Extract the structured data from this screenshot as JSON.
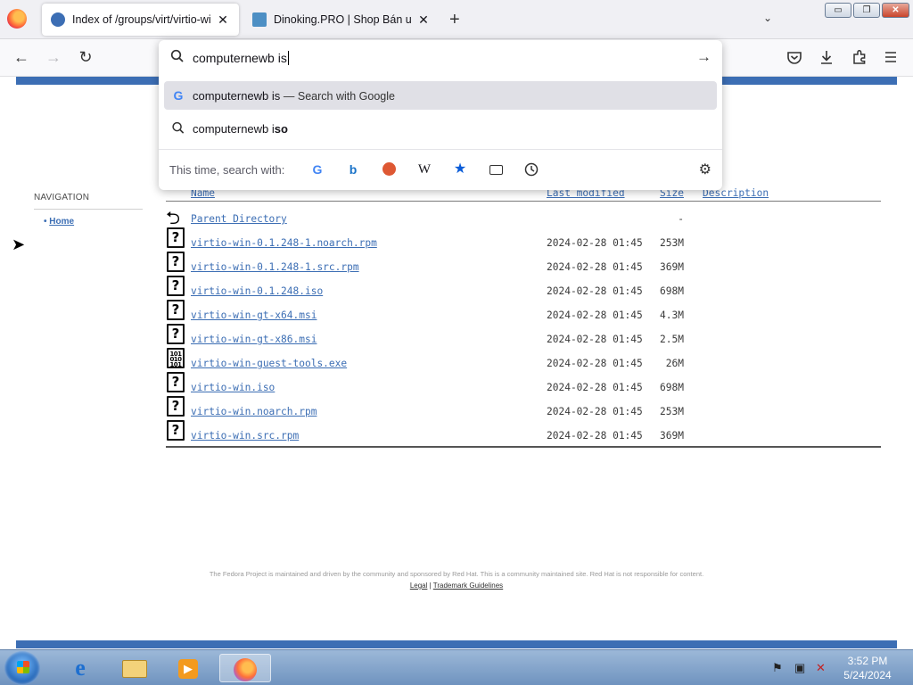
{
  "browser": {
    "tabs": [
      {
        "title": "Index of /groups/virt/virtio-win",
        "active": true
      },
      {
        "title": "Dinoking.PRO | Shop Bán units",
        "active": false
      }
    ],
    "new_tab": "+",
    "close_glyph": "✕",
    "list_tabs_glyph": "⌄",
    "window_controls": {
      "minimize": "▭",
      "restore": "❐",
      "close": "✕"
    }
  },
  "navbar": {
    "back": "←",
    "forward": "→",
    "reload": "↻",
    "right_icons": [
      "pocket-icon",
      "download-icon",
      "extensions-icon",
      "menu-icon"
    ]
  },
  "urlbar": {
    "value": "computernewb is",
    "suggestions": [
      {
        "typed": "computernewb is",
        "suffix": "— Search with Google",
        "icon": "google-icon"
      },
      {
        "typed": "computernewb i",
        "bold": "so",
        "icon": "search-icon"
      }
    ],
    "one_off_label": "This time, search with:",
    "engines": [
      "google",
      "bing",
      "duckduckgo",
      "wikipedia",
      "bookmarks",
      "tabs",
      "history"
    ]
  },
  "sidebar": {
    "heading": "NAVIGATION",
    "items": [
      {
        "label": "Home"
      }
    ]
  },
  "listing": {
    "headers": {
      "name": "Name",
      "modified": "Last modified",
      "size": "Size",
      "description": "Description"
    },
    "parent": {
      "name": "Parent Directory",
      "size": "-"
    },
    "files": [
      {
        "name": "virtio-win-0.1.248-1.noarch.rpm",
        "modified": "2024-02-28 01:45",
        "size": "253M",
        "icon": "unknown"
      },
      {
        "name": "virtio-win-0.1.248-1.src.rpm",
        "modified": "2024-02-28 01:45",
        "size": "369M",
        "icon": "unknown"
      },
      {
        "name": "virtio-win-0.1.248.iso",
        "modified": "2024-02-28 01:45",
        "size": "698M",
        "icon": "unknown"
      },
      {
        "name": "virtio-win-gt-x64.msi",
        "modified": "2024-02-28 01:45",
        "size": "4.3M",
        "icon": "unknown"
      },
      {
        "name": "virtio-win-gt-x86.msi",
        "modified": "2024-02-28 01:45",
        "size": "2.5M",
        "icon": "unknown"
      },
      {
        "name": "virtio-win-guest-tools.exe",
        "modified": "2024-02-28 01:45",
        "size": "26M",
        "icon": "binary"
      },
      {
        "name": "virtio-win.iso",
        "modified": "2024-02-28 01:45",
        "size": "698M",
        "icon": "unknown"
      },
      {
        "name": "virtio-win.noarch.rpm",
        "modified": "2024-02-28 01:45",
        "size": "253M",
        "icon": "unknown"
      },
      {
        "name": "virtio-win.src.rpm",
        "modified": "2024-02-28 01:45",
        "size": "369M",
        "icon": "unknown"
      }
    ]
  },
  "footer": {
    "notice": "The Fedora Project is maintained and driven by the community and sponsored by Red Hat. This is a community maintained site. Red Hat is not responsible for content.",
    "legal": "Legal",
    "separator": "|",
    "trademark": "Trademark Guidelines"
  },
  "taskbar": {
    "time": "3:52 PM",
    "date": "5/24/2024"
  },
  "colors": {
    "fedora_blue": "#3c6eb4",
    "link": "#3c6eb4"
  }
}
